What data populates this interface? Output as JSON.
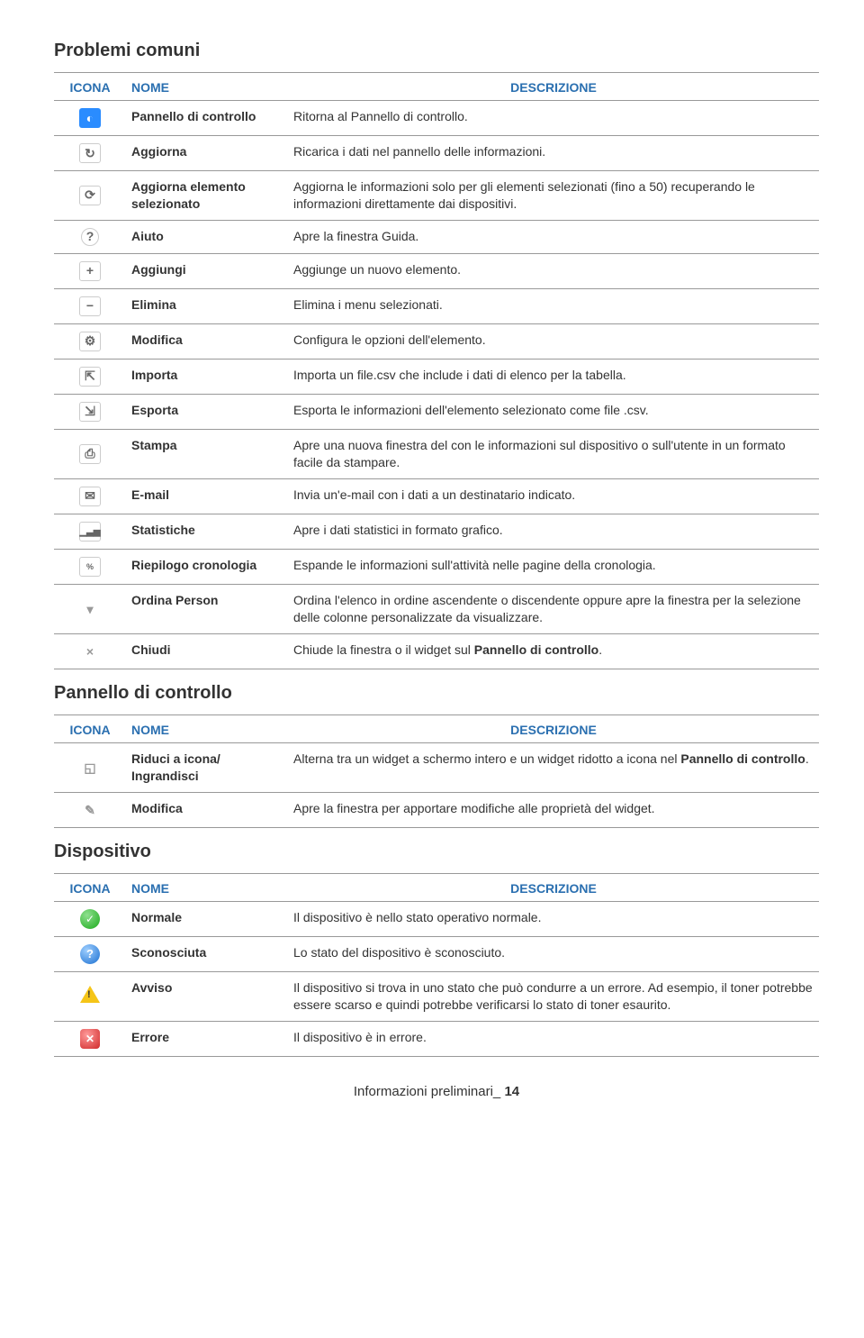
{
  "sections": [
    {
      "title": "Problemi comuni",
      "headers": {
        "icon": "ICONA",
        "name": "NOME",
        "desc": "DESCRIZIONE"
      },
      "rows": [
        {
          "icon": "dashboard",
          "name": "Pannello di controllo",
          "desc": "Ritorna al Pannello di controllo."
        },
        {
          "icon": "refresh",
          "name": "Aggiorna",
          "desc": "Ricarica i dati nel pannello delle informazioni."
        },
        {
          "icon": "refresh-sel",
          "name": "Aggiorna elemento selezionato",
          "desc": "Aggiorna le informazioni solo per gli elementi selezionati (fino a 50) recuperando le informazioni direttamente dai dispositivi."
        },
        {
          "icon": "help",
          "name": "Aiuto",
          "desc": "Apre la finestra Guida."
        },
        {
          "icon": "plus",
          "name": "Aggiungi",
          "desc": "Aggiunge un nuovo elemento."
        },
        {
          "icon": "minus",
          "name": "Elimina",
          "desc": "Elimina i menu selezionati."
        },
        {
          "icon": "gear",
          "name": "Modifica",
          "desc": "Configura le opzioni dell'elemento."
        },
        {
          "icon": "import",
          "name": "Importa",
          "desc": "Importa un file.csv che include i dati di elenco per la tabella."
        },
        {
          "icon": "export",
          "name": "Esporta",
          "desc": "Esporta le informazioni dell'elemento selezionato come file .csv."
        },
        {
          "icon": "print",
          "name": "Stampa",
          "desc": "Apre una nuova finestra del con le informazioni sul dispositivo o sull'utente in un formato facile da stampare."
        },
        {
          "icon": "email",
          "name": "E-mail",
          "desc": "Invia un'e-mail con i dati a un destinatario indicato."
        },
        {
          "icon": "stats",
          "name": "Statistiche",
          "desc": "Apre i dati statistici in formato grafico."
        },
        {
          "icon": "history",
          "name": "Riepilogo cronologia",
          "desc": "Espande le informazioni sull'attività nelle pagine della cronologia."
        },
        {
          "icon": "sort",
          "name": "Ordina Person",
          "desc": "Ordina l'elenco in ordine ascendente o discendente oppure apre la finestra per la selezione delle colonne personalizzate da visualizzare."
        },
        {
          "icon": "close",
          "name": "Chiudi",
          "desc": "Chiude la finestra o il widget sul <b>Pannello di controllo</b>."
        }
      ]
    },
    {
      "title": "Pannello di controllo",
      "headers": {
        "icon": "ICONA",
        "name": "NOME",
        "desc": "DESCRIZIONE"
      },
      "rows": [
        {
          "icon": "minmax",
          "name": "Riduci a icona/ Ingrandisci",
          "desc": "Alterna tra un widget a schermo intero e un widget ridotto a icona nel <b>Pannello di controllo</b>."
        },
        {
          "icon": "edit",
          "name": "Modifica",
          "desc": "Apre la finestra per apportare modifiche alle proprietà del widget."
        }
      ]
    },
    {
      "title": "Dispositivo",
      "headers": {
        "icon": "ICONA",
        "name": "NOME",
        "desc": "DESCRIZIONE"
      },
      "rows": [
        {
          "icon": "status-ok",
          "name": "Normale",
          "desc": "Il dispositivo è nello stato operativo normale."
        },
        {
          "icon": "status-unknown",
          "name": "Sconosciuta",
          "desc": "Lo stato del dispositivo è sconosciuto."
        },
        {
          "icon": "status-warn",
          "name": "Avviso",
          "desc": "Il dispositivo si trova in uno stato che può condurre a un errore. Ad esempio, il toner potrebbe essere scarso e quindi potrebbe verificarsi lo stato di toner esaurito."
        },
        {
          "icon": "status-error",
          "name": "Errore",
          "desc": "Il dispositivo è in errore."
        }
      ]
    }
  ],
  "footer": {
    "text": "Informazioni preliminari",
    "sep": "_ ",
    "page": "14"
  }
}
